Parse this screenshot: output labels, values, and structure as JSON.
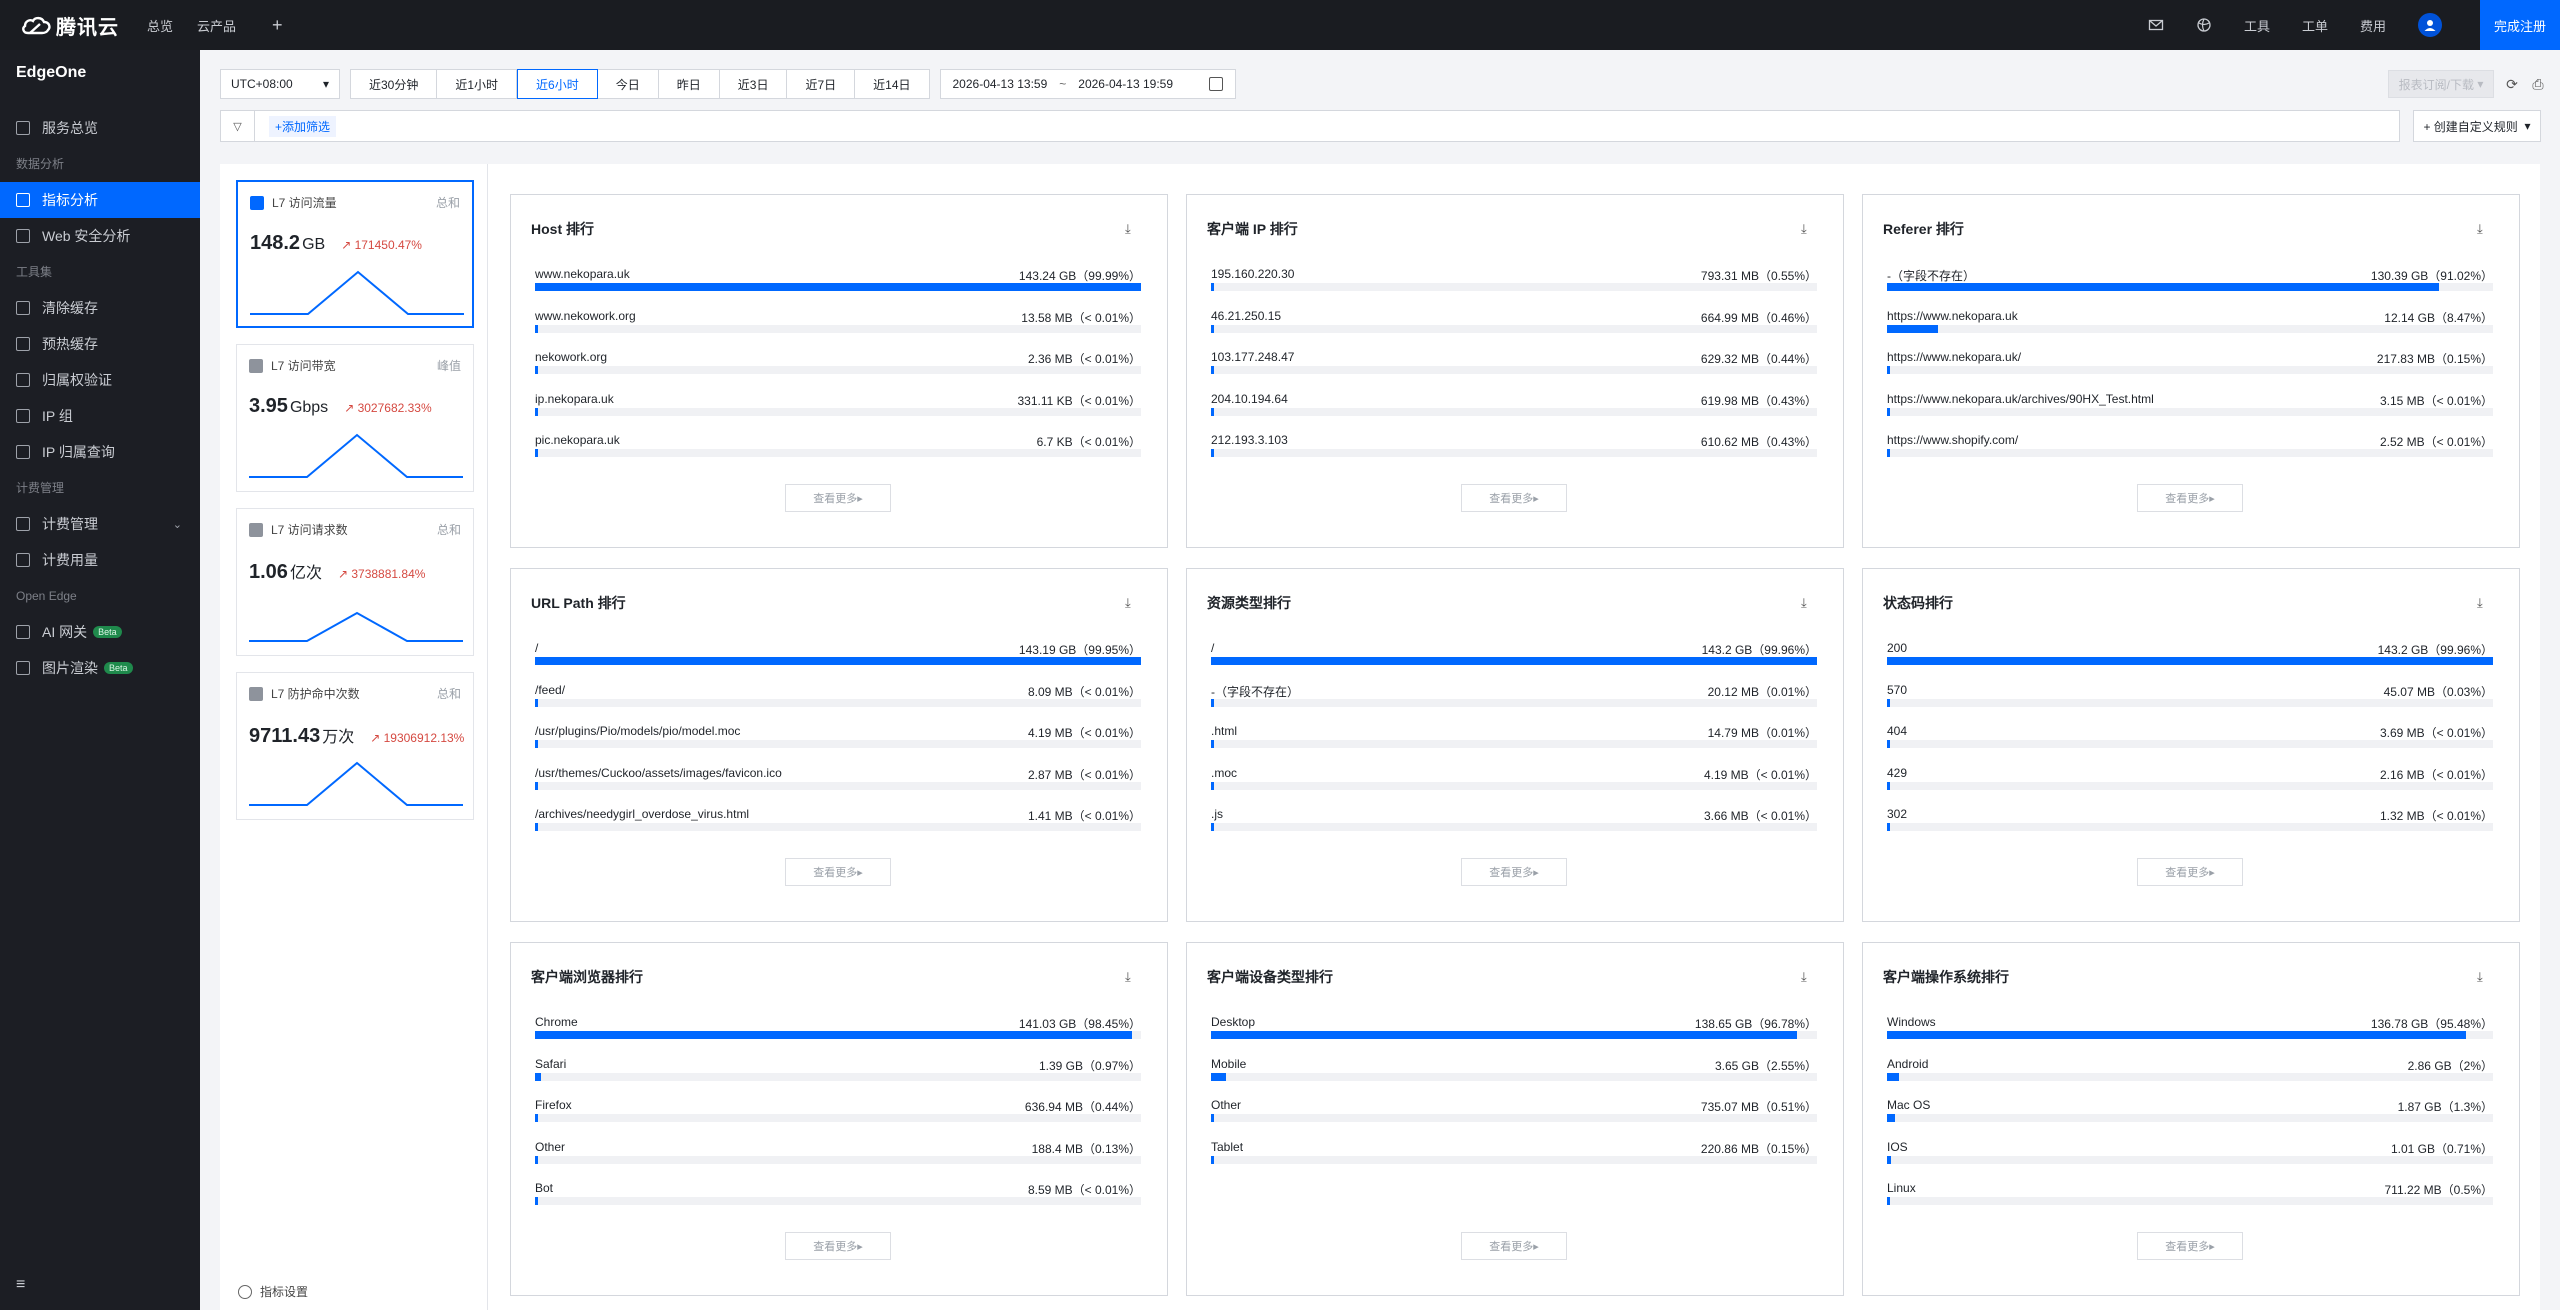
{
  "topbar": {
    "brand": "腾讯云",
    "nav": [
      "总览",
      "云产品"
    ],
    "plus": "+",
    "right": [
      "工具",
      "工单",
      "费用"
    ],
    "cta": "完成注册"
  },
  "sidebar": {
    "title": "EdgeOne",
    "sections": [
      {
        "type": "item",
        "label": "服务总览",
        "icon": "dashboard-icon"
      },
      {
        "type": "group",
        "label": "数据分析"
      },
      {
        "type": "item",
        "label": "指标分析",
        "icon": "chart-icon",
        "active": true
      },
      {
        "type": "item",
        "label": "Web 安全分析",
        "icon": "shield-icon"
      },
      {
        "type": "group",
        "label": "工具集"
      },
      {
        "type": "item",
        "label": "清除缓存",
        "icon": "purge-icon"
      },
      {
        "type": "item",
        "label": "预热缓存",
        "icon": "prefetch-icon"
      },
      {
        "type": "item",
        "label": "归属权验证",
        "icon": "verify-icon"
      },
      {
        "type": "item",
        "label": "IP 组",
        "icon": "ip-group-icon"
      },
      {
        "type": "item",
        "label": "IP 归属查询",
        "icon": "search-icon"
      },
      {
        "type": "group",
        "label": "计费管理"
      },
      {
        "type": "item",
        "label": "计费管理",
        "icon": "billing-icon",
        "caret": true
      },
      {
        "type": "item",
        "label": "计费用量",
        "icon": "usage-icon"
      },
      {
        "type": "group",
        "label": "Open Edge"
      },
      {
        "type": "item",
        "label": "AI 网关",
        "icon": "ai-gateway-icon",
        "badge": "Beta"
      },
      {
        "type": "item",
        "label": "图片渲染",
        "icon": "image-icon",
        "badge": "Beta"
      }
    ],
    "collapse_icon": "≡"
  },
  "filters": {
    "timezone": "UTC+08:00",
    "ranges": [
      "近30分钟",
      "近1小时",
      "近6小时",
      "今日",
      "昨日",
      "近3日",
      "近7日",
      "近14日"
    ],
    "active_range": "近6小时",
    "start": "2026-04-13 13:59",
    "sep": "~",
    "end": "2026-04-13 19:59",
    "subscribe": "报表订阅/下载",
    "add_filter": "添加筛选",
    "custom_rule": "+ 创建自定义规则"
  },
  "metrics": [
    {
      "title": "L7 访问流量",
      "tag": "总和",
      "value": "148.2",
      "unit": "GB",
      "change": "171450.47%",
      "active": true
    },
    {
      "title": "L7 访问带宽",
      "tag": "峰值",
      "value": "3.95",
      "unit": "Gbps",
      "change": "3027682.33%"
    },
    {
      "title": "L7 访问请求数",
      "tag": "总和",
      "value": "1.06",
      "unit": "亿次",
      "change": "3738881.84%"
    },
    {
      "title": "L7 防护命中次数",
      "tag": "总和",
      "value": "9711.43",
      "unit": "万次",
      "change": "19306912.13%"
    }
  ],
  "metric_settings": "指标设置",
  "more_label": "查看更多",
  "panels": [
    {
      "title": "Host 排行",
      "rows": [
        {
          "label": "www.nekopara.uk",
          "value": "143.24 GB（99.99%）",
          "pct": 99.99
        },
        {
          "label": "www.nekowork.org",
          "value": "13.58 MB（< 0.01%）",
          "pct": 0.01
        },
        {
          "label": "nekowork.org",
          "value": "2.36 MB（< 0.01%）",
          "pct": 0.01
        },
        {
          "label": "ip.nekopara.uk",
          "value": "331.11 KB（< 0.01%）",
          "pct": 0.01
        },
        {
          "label": "pic.nekopara.uk",
          "value": "6.7 KB（< 0.01%）",
          "pct": 0.01
        }
      ]
    },
    {
      "title": "客户端 IP 排行",
      "rows": [
        {
          "label": "195.160.220.30",
          "value": "793.31 MB（0.55%）",
          "pct": 0.55
        },
        {
          "label": "46.21.250.15",
          "value": "664.99 MB（0.46%）",
          "pct": 0.46
        },
        {
          "label": "103.177.248.47",
          "value": "629.32 MB（0.44%）",
          "pct": 0.44
        },
        {
          "label": "204.10.194.64",
          "value": "619.98 MB（0.43%）",
          "pct": 0.43
        },
        {
          "label": "212.193.3.103",
          "value": "610.62 MB（0.43%）",
          "pct": 0.43
        }
      ]
    },
    {
      "title": "Referer 排行",
      "rows": [
        {
          "label": "-（字段不存在）",
          "value": "130.39 GB（91.02%）",
          "pct": 91.02
        },
        {
          "label": "https://www.nekopara.uk",
          "value": "12.14 GB（8.47%）",
          "pct": 8.47
        },
        {
          "label": "https://www.nekopara.uk/",
          "value": "217.83 MB（0.15%）",
          "pct": 0.15
        },
        {
          "label": "https://www.nekopara.uk/archives/90HX_Test.html",
          "value": "3.15 MB（< 0.01%）",
          "pct": 0.01
        },
        {
          "label": "https://www.shopify.com/",
          "value": "2.52 MB（< 0.01%）",
          "pct": 0.01
        }
      ]
    },
    {
      "title": "URL Path 排行",
      "rows": [
        {
          "label": "/",
          "value": "143.19 GB（99.95%）",
          "pct": 99.95
        },
        {
          "label": "/feed/",
          "value": "8.09 MB（< 0.01%）",
          "pct": 0.01
        },
        {
          "label": "/usr/plugins/Pio/models/pio/model.moc",
          "value": "4.19 MB（< 0.01%）",
          "pct": 0.01
        },
        {
          "label": "/usr/themes/Cuckoo/assets/images/favicon.ico",
          "value": "2.87 MB（< 0.01%）",
          "pct": 0.01
        },
        {
          "label": "/archives/needygirl_overdose_virus.html",
          "value": "1.41 MB（< 0.01%）",
          "pct": 0.01
        }
      ]
    },
    {
      "title": "资源类型排行",
      "rows": [
        {
          "label": "/",
          "value": "143.2 GB（99.96%）",
          "pct": 99.96
        },
        {
          "label": "-（字段不存在）",
          "value": "20.12 MB（0.01%）",
          "pct": 0.01
        },
        {
          "label": ".html",
          "value": "14.79 MB（0.01%）",
          "pct": 0.01
        },
        {
          "label": ".moc",
          "value": "4.19 MB（< 0.01%）",
          "pct": 0.01
        },
        {
          "label": ".js",
          "value": "3.66 MB（< 0.01%）",
          "pct": 0.01
        }
      ]
    },
    {
      "title": "状态码排行",
      "rows": [
        {
          "label": "200",
          "value": "143.2 GB（99.96%）",
          "pct": 99.96
        },
        {
          "label": "570",
          "value": "45.07 MB（0.03%）",
          "pct": 0.03
        },
        {
          "label": "404",
          "value": "3.69 MB（< 0.01%）",
          "pct": 0.01
        },
        {
          "label": "429",
          "value": "2.16 MB（< 0.01%）",
          "pct": 0.01
        },
        {
          "label": "302",
          "value": "1.32 MB（< 0.01%）",
          "pct": 0.01
        }
      ]
    },
    {
      "title": "客户端浏览器排行",
      "rows": [
        {
          "label": "Chrome",
          "value": "141.03 GB（98.45%）",
          "pct": 98.45
        },
        {
          "label": "Safari",
          "value": "1.39 GB（0.97%）",
          "pct": 0.97
        },
        {
          "label": "Firefox",
          "value": "636.94 MB（0.44%）",
          "pct": 0.44
        },
        {
          "label": "Other",
          "value": "188.4 MB（0.13%）",
          "pct": 0.13
        },
        {
          "label": "Bot",
          "value": "8.59 MB（< 0.01%）",
          "pct": 0.01
        }
      ]
    },
    {
      "title": "客户端设备类型排行",
      "rows": [
        {
          "label": "Desktop",
          "value": "138.65 GB（96.78%）",
          "pct": 96.78
        },
        {
          "label": "Mobile",
          "value": "3.65 GB（2.55%）",
          "pct": 2.55
        },
        {
          "label": "Other",
          "value": "735.07 MB（0.51%）",
          "pct": 0.51
        },
        {
          "label": "Tablet",
          "value": "220.86 MB（0.15%）",
          "pct": 0.15
        }
      ]
    },
    {
      "title": "客户端操作系统排行",
      "rows": [
        {
          "label": "Windows",
          "value": "136.78 GB（95.48%）",
          "pct": 95.48
        },
        {
          "label": "Android",
          "value": "2.86 GB（2%）",
          "pct": 2
        },
        {
          "label": "Mac OS",
          "value": "1.87 GB（1.3%）",
          "pct": 1.3
        },
        {
          "label": "IOS",
          "value": "1.01 GB（0.71%）",
          "pct": 0.71
        },
        {
          "label": "Linux",
          "value": "711.22 MB（0.5%）",
          "pct": 0.5
        }
      ]
    }
  ]
}
